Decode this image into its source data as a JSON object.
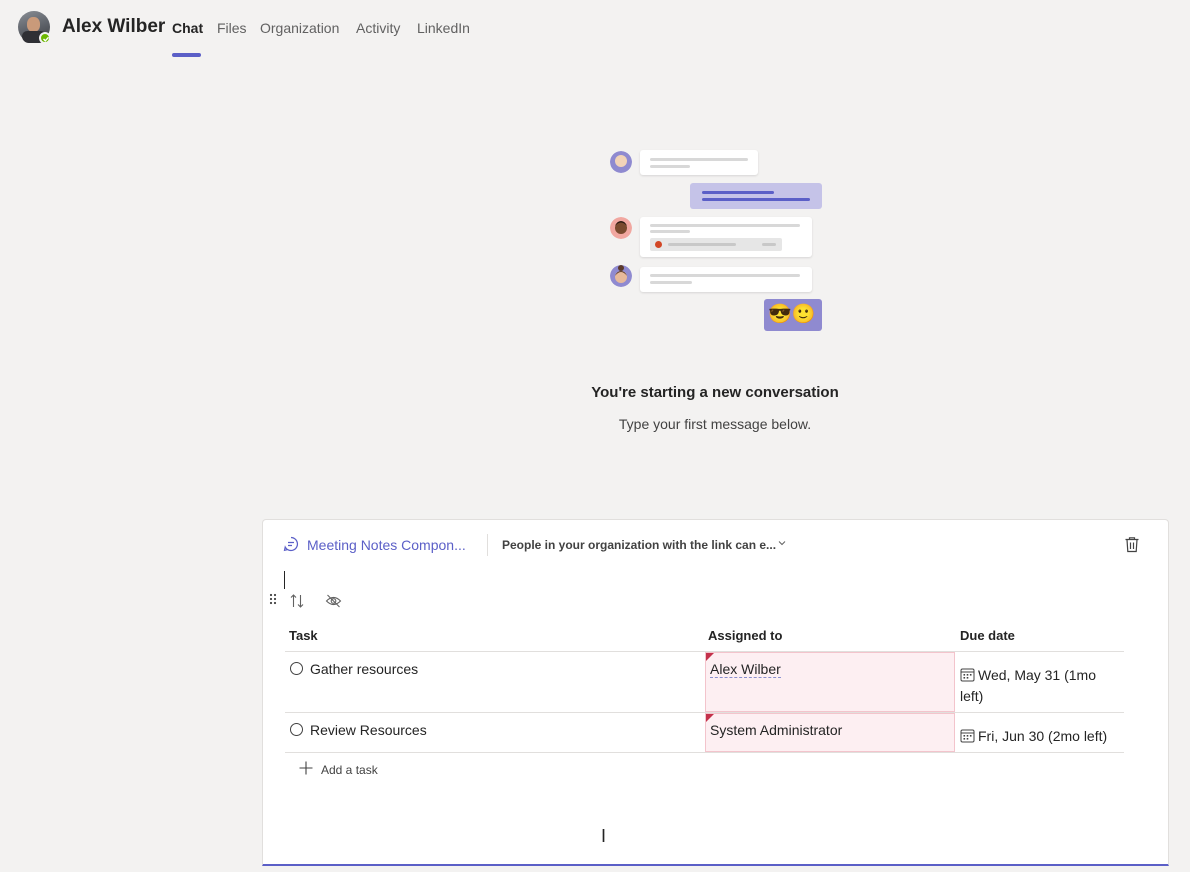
{
  "header": {
    "user_name": "Alex Wilber",
    "presence": "available",
    "tabs": [
      {
        "label": "Chat",
        "active": true
      },
      {
        "label": "Files",
        "active": false
      },
      {
        "label": "Organization",
        "active": false
      },
      {
        "label": "Activity",
        "active": false
      },
      {
        "label": "LinkedIn",
        "active": false
      }
    ]
  },
  "conversation": {
    "title": "You're starting a new conversation",
    "subtitle": "Type your first message below.",
    "emoji": "😎🙂"
  },
  "component": {
    "name": "Meeting Notes Compon...",
    "permission": "People in your organization with the link can e...",
    "columns": {
      "task": "Task",
      "assigned_to": "Assigned to",
      "due_date": "Due date"
    },
    "rows": [
      {
        "task": "Gather resources",
        "assigned_to": "Alex Wilber",
        "due": "Wed, May 31 (1mo left)"
      },
      {
        "task": "Review Resources",
        "assigned_to": "System Administrator",
        "due": "Fri, Jun 30 (2mo left)"
      }
    ],
    "add_task_label": "Add a task"
  },
  "colors": {
    "accent": "#5b5fc7",
    "presence": "#6bb700",
    "assigned_highlight": "#fdeff2"
  },
  "icons": [
    "loop-icon",
    "chevron-down-icon",
    "trash-icon",
    "drag-handle-icon",
    "sort-icon",
    "hide-icon",
    "calendar-icon",
    "plus-icon",
    "checkmark-icon"
  ]
}
